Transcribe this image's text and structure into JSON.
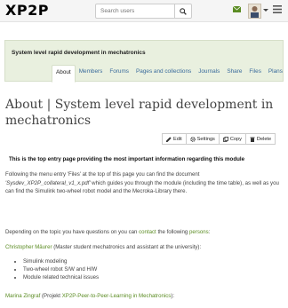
{
  "navbar": {
    "logo": "XP2P",
    "search_placeholder": "Search users"
  },
  "group": {
    "title": "System level rapid development in mechatronics",
    "tabs": [
      "About",
      "Members",
      "Forums",
      "Pages and collections",
      "Journals",
      "Share",
      "Files",
      "Plans"
    ],
    "active_tab": "About"
  },
  "page": {
    "title": "About | System level rapid development in mechatronics",
    "actions": [
      "Edit",
      "Settings",
      "Copy",
      "Delete"
    ],
    "lead": "This is the top entry page providing the most important information regarding this module",
    "para1_a": "Following the menu entry 'Files' at the top of this page you can find the document ",
    "para1_doc": "'Sysdev_XP2P_collateral_v1_x.pdf'",
    "para1_b": " which guides you through the module (including the time table), as well as you can find the Simulink two-wheel robot model and the Mecroka-Library there.",
    "para2_a": "Depending on the topic you have questions on you can ",
    "para2_b": "contact",
    "para2_c": " the following ",
    "para2_d": "persons",
    "para2_e": ":",
    "person1_name": "Christopher Mäurer",
    "person1_desc": " (Master student mechatronics and assistant at the university):",
    "person1_topics": [
      "Simulink modeling",
      "Two-wheel robot S/W and H/W",
      "Module related technical issues"
    ],
    "person2_name": "Marina Zingraf",
    "person2_a": " (Projekt ",
    "person2_link": "XP2P-Peer-to-Peer-Learning in Mechatronics",
    "person2_b": "):"
  },
  "colors": {
    "link": "#3a6b9c",
    "accent_green": "#5b8c23",
    "group_bg": "#e9f0df"
  }
}
